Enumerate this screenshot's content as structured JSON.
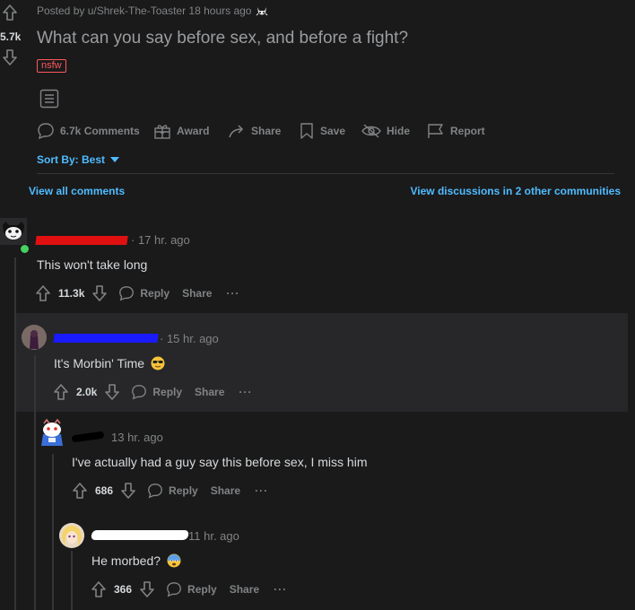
{
  "post": {
    "vote_count": "5.7k",
    "meta": "Posted by u/Shrek-The-Toaster 18 hours ago",
    "title": "What can you say before sex, and before a fight?",
    "tag": "nsfw",
    "actions": {
      "comments": "6.7k Comments",
      "award": "Award",
      "share": "Share",
      "save": "Save",
      "hide": "Hide",
      "report": "Report"
    }
  },
  "sort": {
    "label": "Sort By: Best"
  },
  "links": {
    "view_all": "View all comments",
    "other_communities": "View discussions in 2 other communities"
  },
  "comments": [
    {
      "time": "· 17 hr. ago",
      "body": "This won't take long",
      "score": "11.3k",
      "reply": "Reply",
      "share": "Share",
      "more": "···"
    },
    {
      "time": "· 15 hr. ago",
      "body": "It's Morbin' Time",
      "score": "2.0k",
      "reply": "Reply",
      "share": "Share",
      "more": "···"
    },
    {
      "time": "13 hr. ago",
      "body": "I've actually had a guy say this before sex, I miss him",
      "score": "686",
      "reply": "Reply",
      "share": "Share",
      "more": "···"
    },
    {
      "time": "11 hr. ago",
      "body": "He morbed?",
      "score": "366",
      "reply": "Reply",
      "share": "Share",
      "more": "···"
    }
  ],
  "colors": {
    "background": "#1a1a1b",
    "highlight": "#272729",
    "link": "#4fbcff",
    "nsfw": "#ff585b",
    "redaction_red": "#e01010",
    "redaction_blue": "#1a1aff"
  }
}
